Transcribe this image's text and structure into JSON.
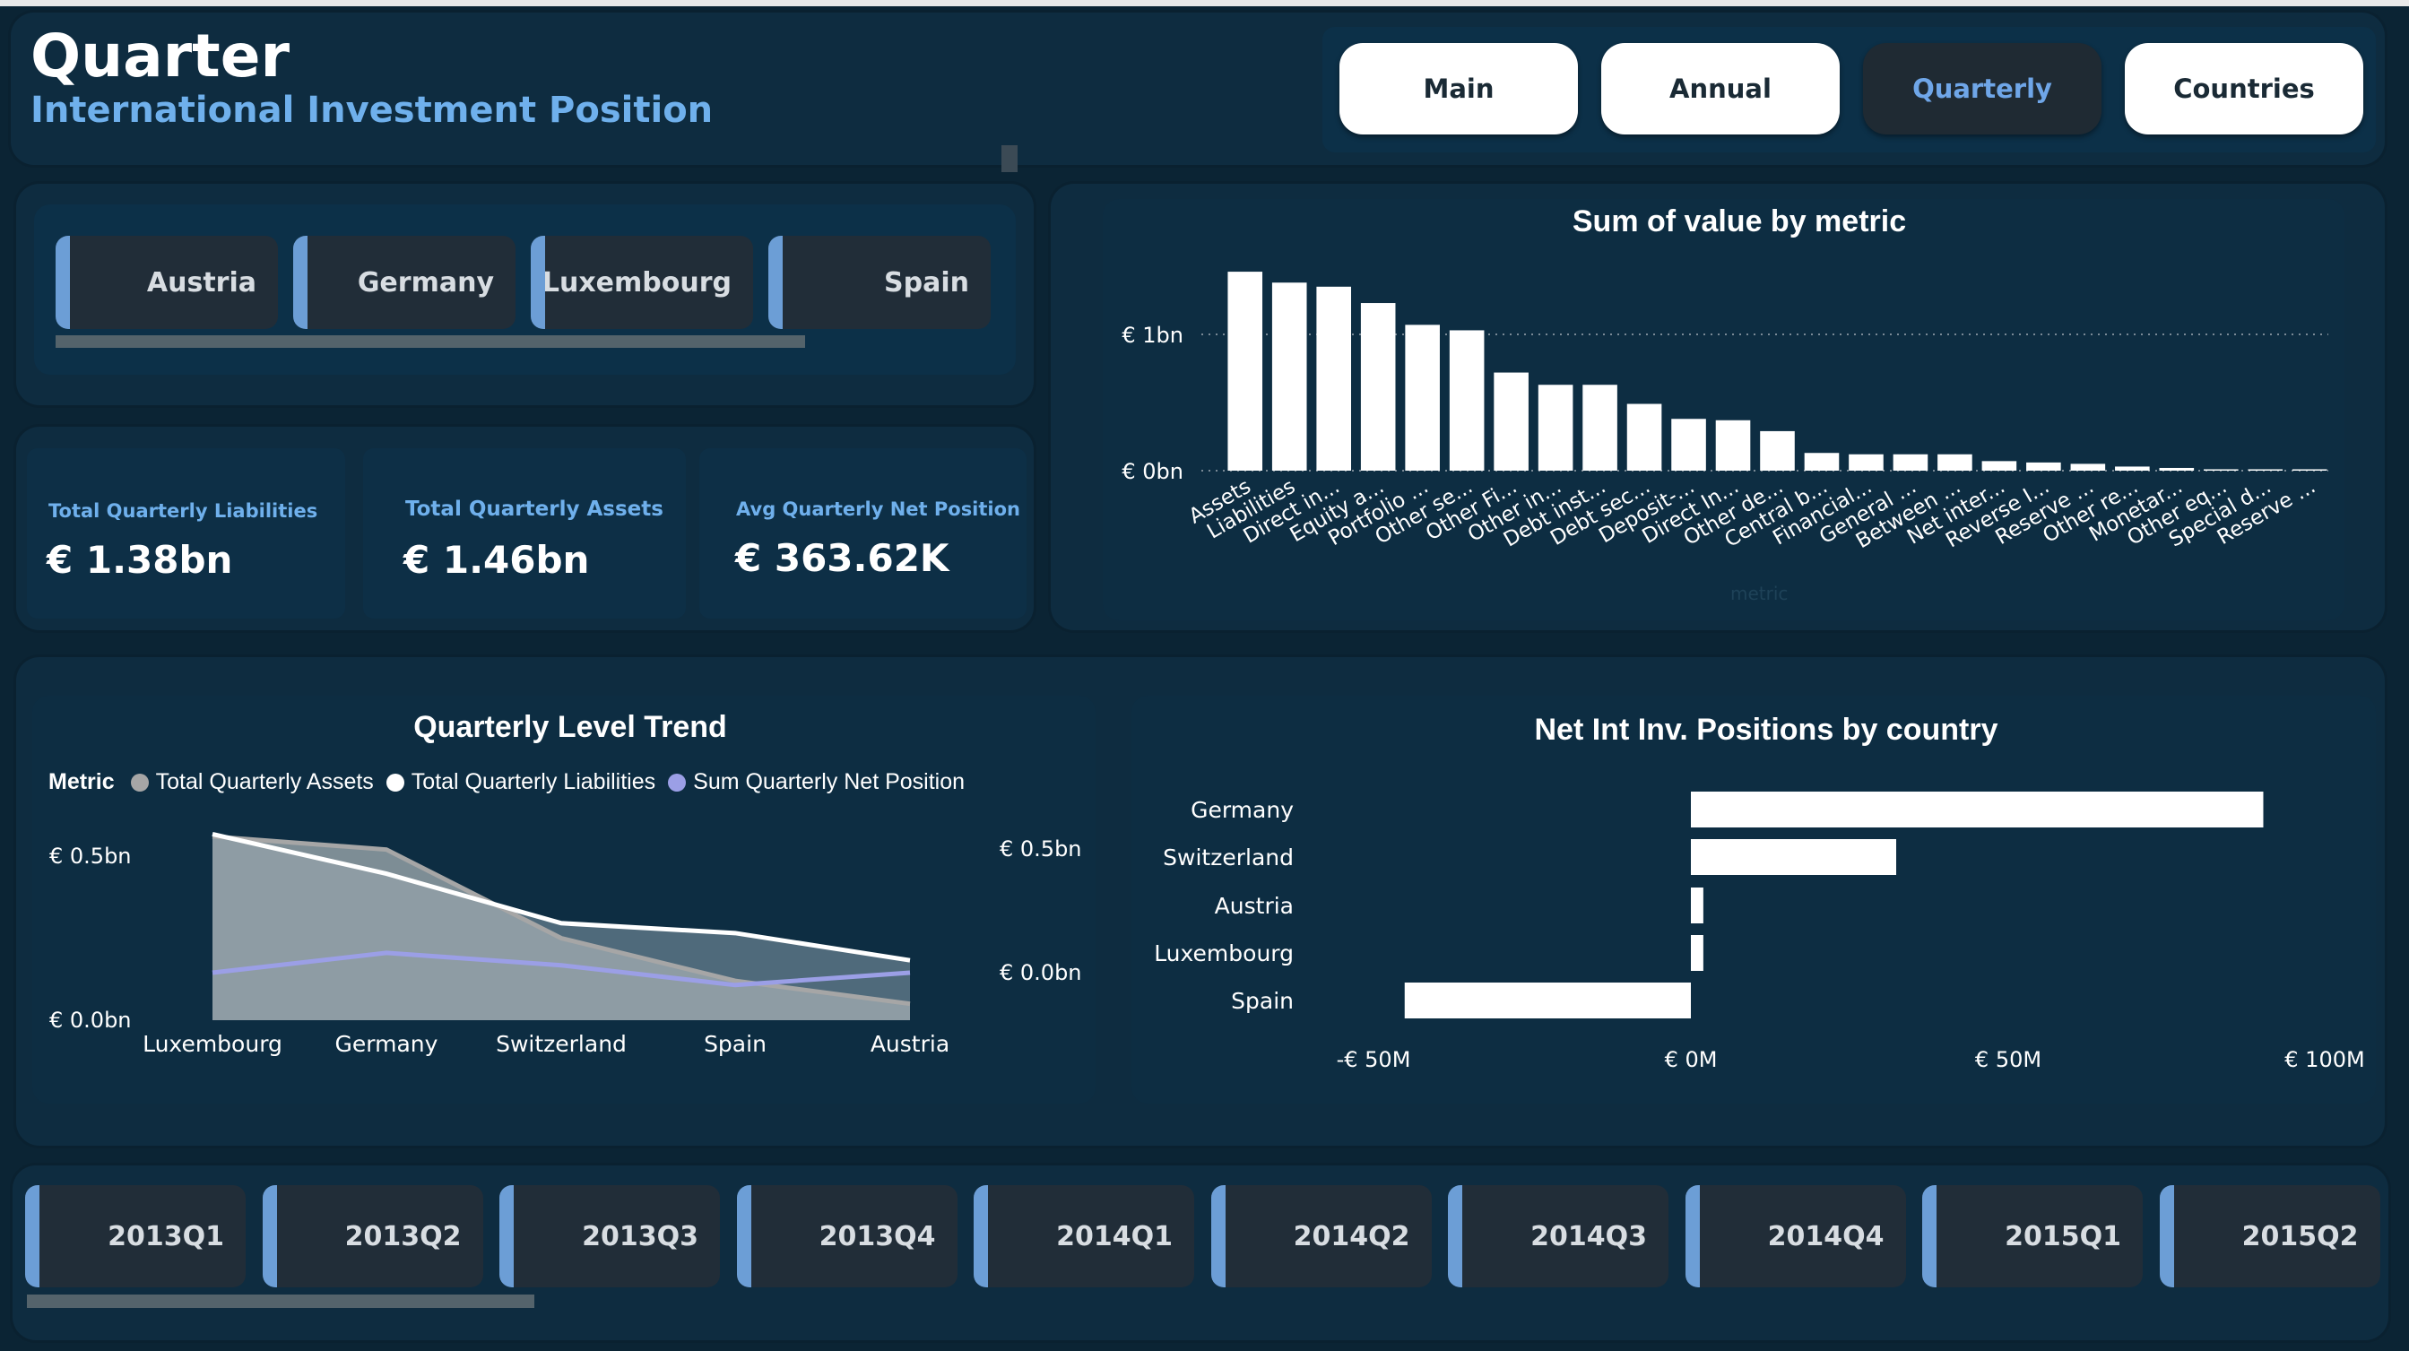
{
  "header": {
    "title": "Quarter",
    "subtitle": "International Investment Position"
  },
  "nav": [
    "Main",
    "Annual",
    "Quarterly",
    "Countries"
  ],
  "nav_active": "Quarterly",
  "country_slicer": [
    "Austria",
    "Germany",
    "Luxembourg",
    "Spain"
  ],
  "kpis": [
    {
      "label": "Total Quarterly Liabilities",
      "value": "€ 1.38bn"
    },
    {
      "label": "Total Quarterly Assets",
      "value": "€ 1.46bn"
    },
    {
      "label": "Avg Quarterly Net Position",
      "value": "€ 363.62K"
    }
  ],
  "quarter_slicer": [
    "2013Q1",
    "2013Q2",
    "2013Q3",
    "2013Q4",
    "2014Q1",
    "2014Q2",
    "2014Q3",
    "2014Q4",
    "2015Q1",
    "2015Q2"
  ],
  "colors": {
    "accent": "#6c9ed6",
    "bar": "#ffffff",
    "assets": "#a6a6a6",
    "liabilities": "#ffffff",
    "net": "#9b9fe6",
    "label": "#6fb0ec"
  },
  "chart_data": [
    {
      "type": "bar",
      "title": "Sum of value by metric",
      "xlabel": "metric",
      "ylabel": "",
      "y_tick_labels": [
        "€ 0bn",
        "€ 1bn"
      ],
      "ylim": [
        0,
        1.7
      ],
      "grid": true,
      "categories": [
        "Assets",
        "Liabilities",
        "Direct in...",
        "Equity a...",
        "Portfolio ...",
        "Other se...",
        "Other Fi...",
        "Other in...",
        "Debt inst...",
        "Debt sec...",
        "Deposit-...",
        "Direct In...",
        "Other de...",
        "Central b...",
        "Financial...",
        "General ...",
        "Between ...",
        "Net inter...",
        "Reverse I...",
        "Reserve ...",
        "Other re...",
        "Monetar...",
        "Other eq...",
        "Special d...",
        "Reserve ..."
      ],
      "values": [
        1.46,
        1.38,
        1.35,
        1.23,
        1.07,
        1.03,
        0.72,
        0.63,
        0.63,
        0.49,
        0.38,
        0.37,
        0.29,
        0.13,
        0.12,
        0.12,
        0.12,
        0.07,
        0.06,
        0.05,
        0.03,
        0.02,
        0.01,
        0.01,
        0.01
      ]
    },
    {
      "type": "area",
      "title": "Quarterly Level Trend",
      "legend_title": "Metric",
      "legend_position": "top-left",
      "categories": [
        "Luxembourg",
        "Germany",
        "Switzerland",
        "Spain",
        "Austria"
      ],
      "y_tick_labels_left": [
        "€ 0.0bn",
        "€ 0.5bn"
      ],
      "y_tick_labels_right": [
        "€ 0.0bn",
        "€ 0.5bn"
      ],
      "ylim": [
        0,
        0.65
      ],
      "y2lim": [
        -0.2,
        0.7
      ],
      "series": [
        {
          "name": "Total Quarterly Assets",
          "axis": "left",
          "values": [
            0.56,
            0.52,
            0.25,
            0.12,
            0.05
          ]
        },
        {
          "name": "Total Quarterly Liabilities",
          "axis": "right",
          "values": [
            0.56,
            0.4,
            0.2,
            0.16,
            0.05
          ]
        },
        {
          "name": "Sum Quarterly Net Position",
          "axis": "right",
          "values": [
            0.0,
            0.08,
            0.03,
            -0.05,
            0.0
          ]
        }
      ]
    },
    {
      "type": "bar",
      "orientation": "horizontal",
      "title": "Net Int Inv. Positions by country",
      "categories": [
        "Germany",
        "Switzerland",
        "Austria",
        "Luxembourg",
        "Spain"
      ],
      "values": [
        92,
        33,
        2,
        2,
        -46
      ],
      "x_tick_labels": [
        "-€ 50M",
        "€ 0M",
        "€ 50M",
        "€ 100M"
      ],
      "xlim": [
        -55,
        107
      ]
    }
  ]
}
